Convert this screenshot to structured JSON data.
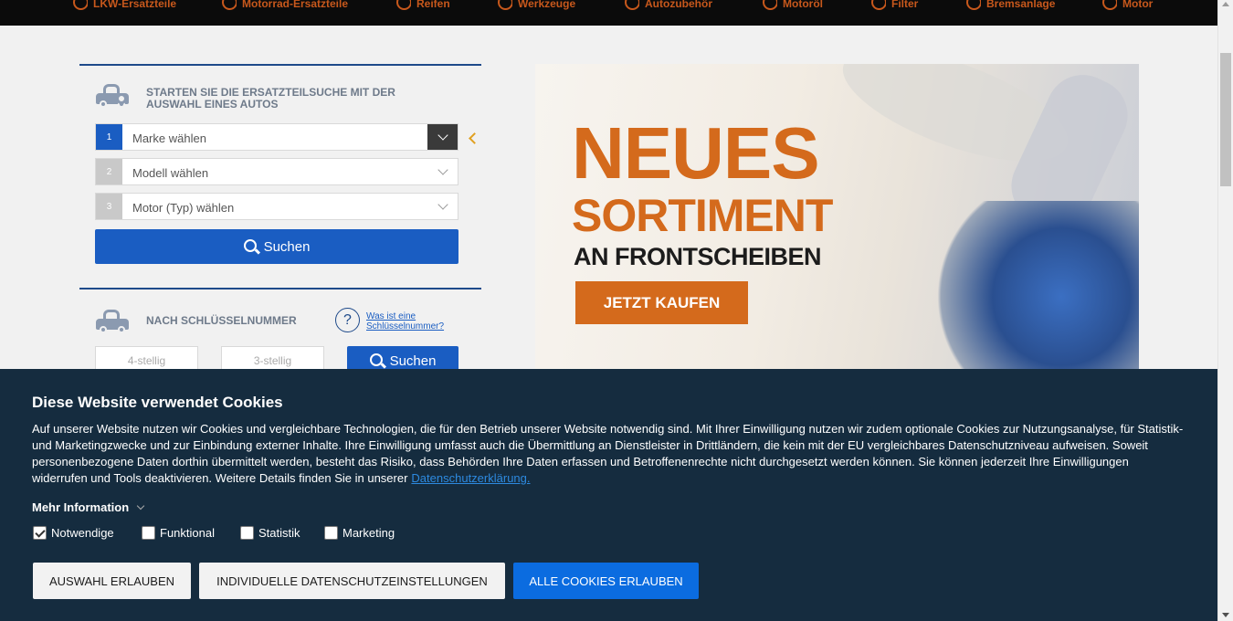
{
  "topnav": {
    "items": [
      {
        "label": "LKW-Ersatzteile",
        "icon": "truck-icon"
      },
      {
        "label": "Motorrad-Ersatzteile",
        "icon": "motorcycle-icon"
      },
      {
        "label": "Reifen",
        "icon": "tire-icon"
      },
      {
        "label": "Werkzeuge",
        "icon": "tools-icon"
      },
      {
        "label": "Autozubehör",
        "icon": "first-aid-icon"
      },
      {
        "label": "Motoröl",
        "icon": "oil-can-icon"
      },
      {
        "label": "Filter",
        "icon": "filter-icon"
      },
      {
        "label": "Bremsanlage",
        "icon": "brake-disc-icon"
      },
      {
        "label": "Motor",
        "icon": "engine-icon"
      }
    ],
    "accent_color": "#c7581c"
  },
  "search_by_car": {
    "title": "STARTEN SIE DIE ERSATZTEILSUCHE MIT DER AUSWAHL EINES AUTOS",
    "steps": [
      {
        "num": "1",
        "label": "Marke wählen"
      },
      {
        "num": "2",
        "label": "Modell wählen"
      },
      {
        "num": "3",
        "label": "Motor (Typ) wählen"
      }
    ],
    "search_label": "Suchen"
  },
  "search_by_key": {
    "title": "NACH SCHLÜSSELNUMMER",
    "help_symbol": "?",
    "help_link": "Was ist eine Schlüsselnummer?",
    "input1_placeholder": "4-stellig",
    "input2_placeholder": "3-stellig",
    "search_label": "Suchen"
  },
  "banner": {
    "line1": "NEUES",
    "line2": "SORTIMENT",
    "line3": "AN FRONTSCHEIBEN",
    "cta": "JETZT KAUFEN",
    "accent_color": "#d46a1c"
  },
  "cookie": {
    "title": "Diese Website verwendet Cookies",
    "text": "Auf unserer Website nutzen wir Cookies und vergleichbare Technologien, die für den Betrieb unserer Website notwendig sind. Mit Ihrer Einwilligung nutzen wir zudem optionale Cookies zur Nutzungsanalyse, für Statistik- und Marketingzwecke und zur Einbindung externer Inhalte. Ihre Einwilligung umfasst auch die Übermittlung an Dienstleister in Drittländern, die kein mit der EU vergleichbares Datenschutzniveau aufweisen. Soweit personenbezogene Daten dorthin übermittelt werden, besteht das Risiko, dass Behörden Ihre Daten erfassen und Betroffenenrechte nicht durchgesetzt werden können. Sie können jederzeit Ihre Einwilligungen widerrufen und Tools deaktivieren. Weitere Details finden Sie in unserer",
    "link": "Datenschutzerklärung.",
    "more_info": "Mehr Information",
    "checkboxes": [
      {
        "label": "Notwendige",
        "checked": true
      },
      {
        "label": "Funktional",
        "checked": false
      },
      {
        "label": "Statistik",
        "checked": false
      },
      {
        "label": "Marketing",
        "checked": false
      }
    ],
    "btn_selection": "AUSWAHL ERLAUBEN",
    "btn_individual": "INDIVIDUELLE DATENSCHUTZEINSTELLUNGEN",
    "btn_all": "ALLE COOKIES ERLAUBEN",
    "background_color": "#152c3f",
    "primary_color": "#0b6ce0"
  }
}
